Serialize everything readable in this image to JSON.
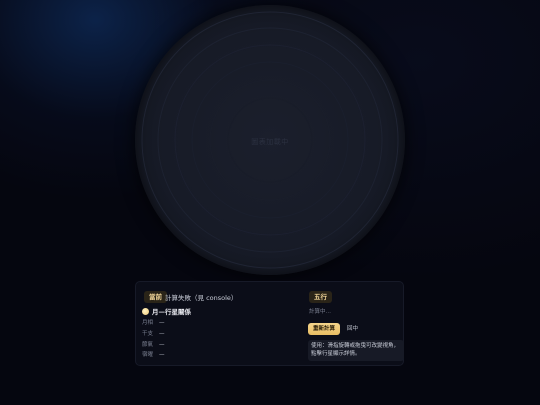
{
  "disc": {
    "placeholder": "圖表加載中"
  },
  "panel": {
    "current_tag": "當前",
    "status": "計算失敗（見 console）",
    "moon_title": "月—行星關係",
    "fields": [
      {
        "label": "月相",
        "value": "—"
      },
      {
        "label": "干支",
        "value": "—"
      },
      {
        "label": "節氣",
        "value": "—"
      },
      {
        "label": "宿曜",
        "value": "—"
      }
    ],
    "wuxing_tag": "五行",
    "wuxing_status": "計算中…",
    "recalc_label": "重新計算",
    "center_label": "回中",
    "usage_note": "使用：滑指旋轉或拖曳可改變視角，點擊行星顯示詳情。"
  },
  "colors": {
    "background": "#05060f",
    "accent": "#f3d79a",
    "button": "#e8bd63"
  }
}
